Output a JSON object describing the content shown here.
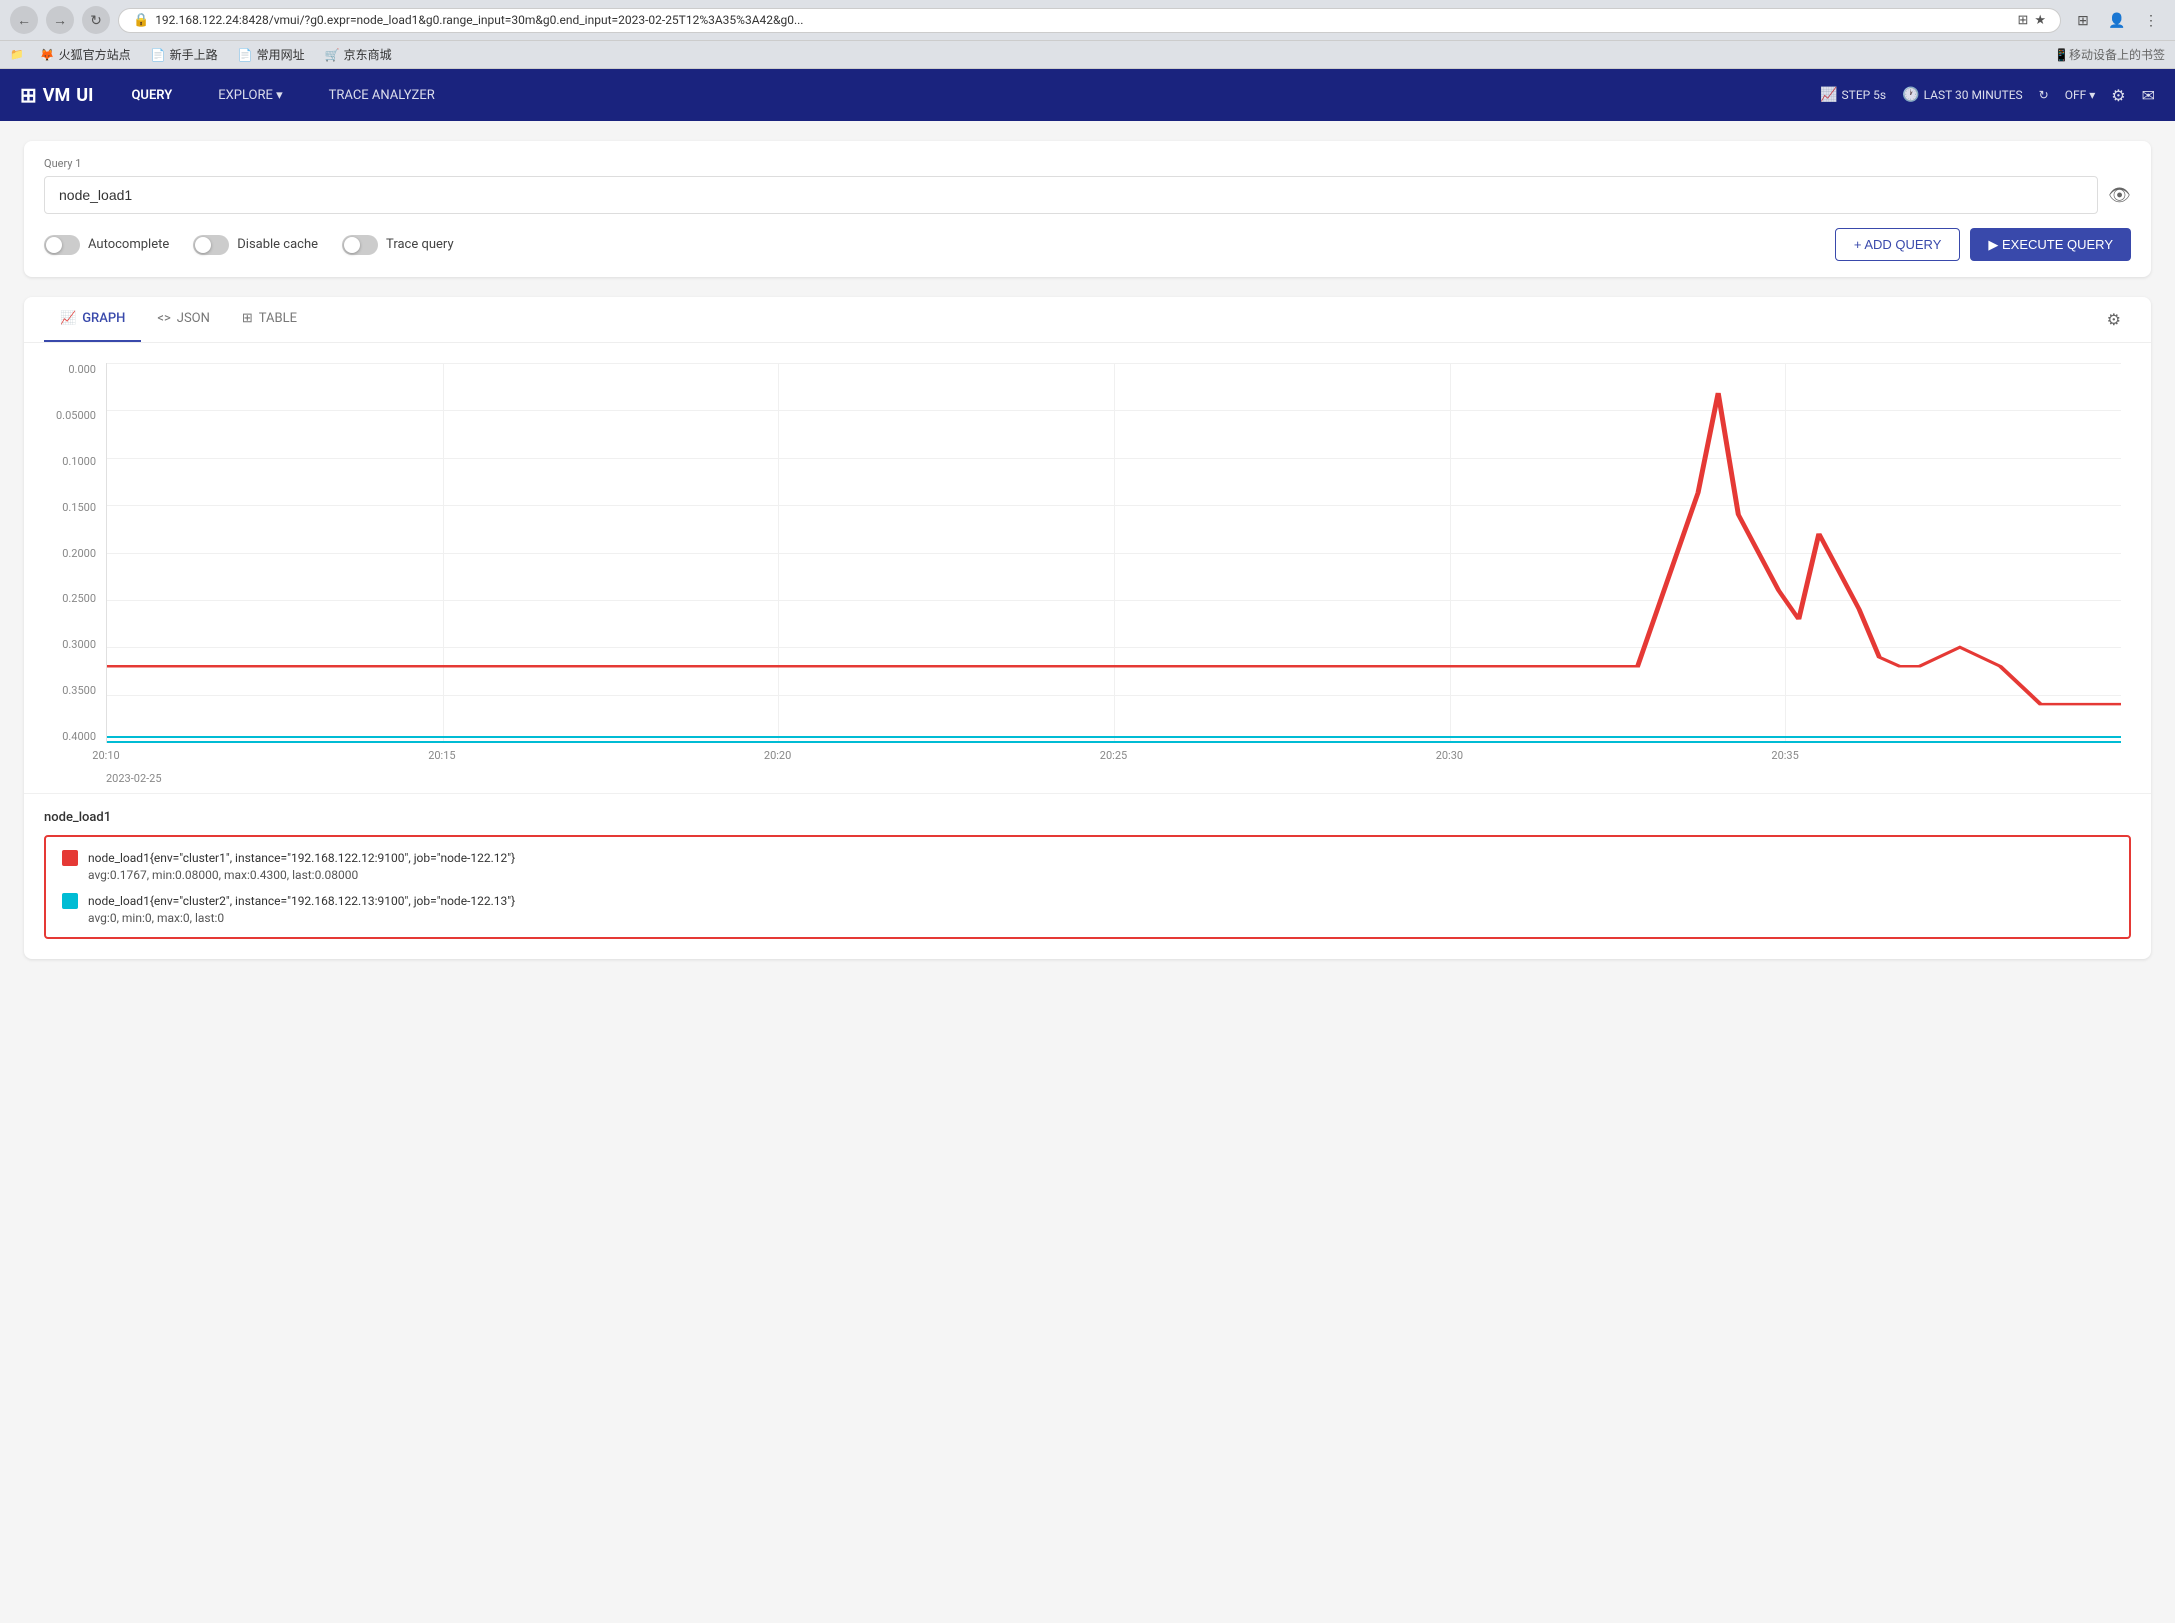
{
  "browser": {
    "url": "192.168.122.24:8428/vmui/?g0.expr=node_load1&g0.range_input=30m&g0.end_input=2023-02-25T12%3A35%3A42&g0...",
    "nav_back": "←",
    "nav_forward": "→",
    "nav_refresh": "↻",
    "bookmarks": [
      "火狐官方站点",
      "新手上路",
      "常用网址",
      "京东商城"
    ]
  },
  "header": {
    "logo": "VMUI",
    "nav_items": [
      {
        "label": "QUERY",
        "active": true
      },
      {
        "label": "EXPLORE ▾",
        "active": false
      },
      {
        "label": "TRACE ANALYZER",
        "active": false
      }
    ],
    "step": "STEP 5s",
    "time_range": "LAST 30 MINUTES",
    "settings_icon": "⚙",
    "message_icon": "✉",
    "off_label": "OFF ▾"
  },
  "query": {
    "label": "Query 1",
    "value": "node_load1",
    "placeholder": "",
    "autocomplete_label": "Autocomplete",
    "autocomplete_on": false,
    "disable_cache_label": "Disable cache",
    "disable_cache_on": false,
    "trace_query_label": "Trace query",
    "trace_query_on": false,
    "add_query_label": "+ ADD QUERY",
    "execute_label": "▶ EXECUTE QUERY"
  },
  "tabs": [
    {
      "label": "GRAPH",
      "icon": "📈",
      "active": true
    },
    {
      "label": "JSON",
      "icon": "<>",
      "active": false
    },
    {
      "label": "TABLE",
      "icon": "⊞",
      "active": false
    }
  ],
  "chart": {
    "y_labels": [
      "0.000",
      "0.05000",
      "0.1000",
      "0.1500",
      "0.2000",
      "0.2500",
      "0.3000",
      "0.3500",
      "0.4000"
    ],
    "x_labels": [
      "20:10",
      "20:15",
      "20:20",
      "20:25",
      "20:30",
      "20:35"
    ],
    "x_date": "2023-02-25"
  },
  "legend": {
    "title": "node_load1",
    "items": [
      {
        "color": "#e53935",
        "label": "node_load1{env=\"cluster1\", instance=\"192.168.122.12:9100\", job=\"node-122.12\"}",
        "stats": "avg:0.1767, min:0.08000, max:0.4300, last:0.08000"
      },
      {
        "color": "#00bcd4",
        "label": "node_load1{env=\"cluster2\", instance=\"192.168.122.13:9100\", job=\"node-122.13\"}",
        "stats": "avg:0, min:0, max:0, last:0"
      }
    ]
  }
}
